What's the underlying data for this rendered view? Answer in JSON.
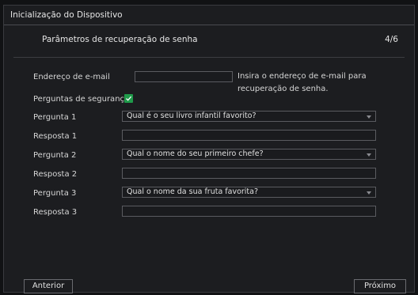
{
  "window": {
    "title": "Inicialização do Dispositivo"
  },
  "header": {
    "title": "Parâmetros de recuperação de senha",
    "step": "4/6"
  },
  "email": {
    "label": "Endereço de e-mail",
    "value": "",
    "hint": "Insira o endereço de e-mail para recuperação de senha."
  },
  "security": {
    "label": "Perguntas de segurança",
    "checked": true
  },
  "questions": [
    {
      "label": "Pergunta 1",
      "value": "Qual é o seu livro infantil favorito?",
      "answer_label": "Resposta 1",
      "answer": ""
    },
    {
      "label": "Pergunta 2",
      "value": "Qual o nome do seu primeiro chefe?",
      "answer_label": "Resposta 2",
      "answer": ""
    },
    {
      "label": "Pergunta 3",
      "value": "Qual o nome da sua fruta favorita?",
      "answer_label": "Resposta 3",
      "answer": ""
    }
  ],
  "buttons": {
    "previous": "Anterior",
    "next": "Próximo"
  },
  "colors": {
    "accent": "#1f9a4a",
    "background": "#1c1d20",
    "border": "#5a5b60"
  }
}
